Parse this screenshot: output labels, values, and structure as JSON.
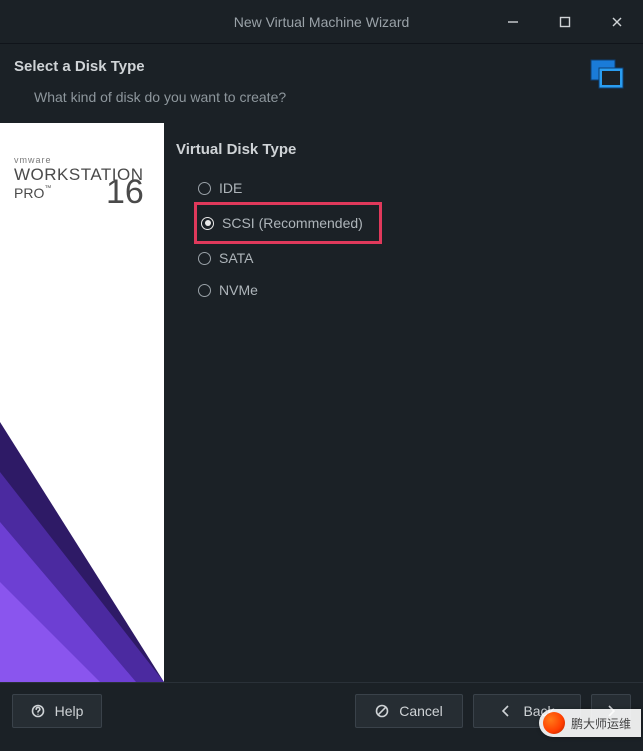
{
  "window": {
    "title": "New Virtual Machine Wizard"
  },
  "header": {
    "title": "Select a Disk Type",
    "subtitle": "What kind of disk do you want to create?"
  },
  "sidebar": {
    "brand_line1": "vmware",
    "brand_line2": "WORKSTATION",
    "brand_line3": "PRO",
    "brand_tm": "™",
    "brand_version": "16"
  },
  "content": {
    "section_title": "Virtual Disk Type",
    "options": {
      "ide": "IDE",
      "scsi": "SCSI (Recommended)",
      "sata": "SATA",
      "nvme": "NVMe"
    },
    "selected": "scsi"
  },
  "footer": {
    "help": "Help",
    "cancel": "Cancel",
    "back": "Back",
    "next": "Next"
  },
  "watermark": {
    "text": "鹏大师运维"
  }
}
